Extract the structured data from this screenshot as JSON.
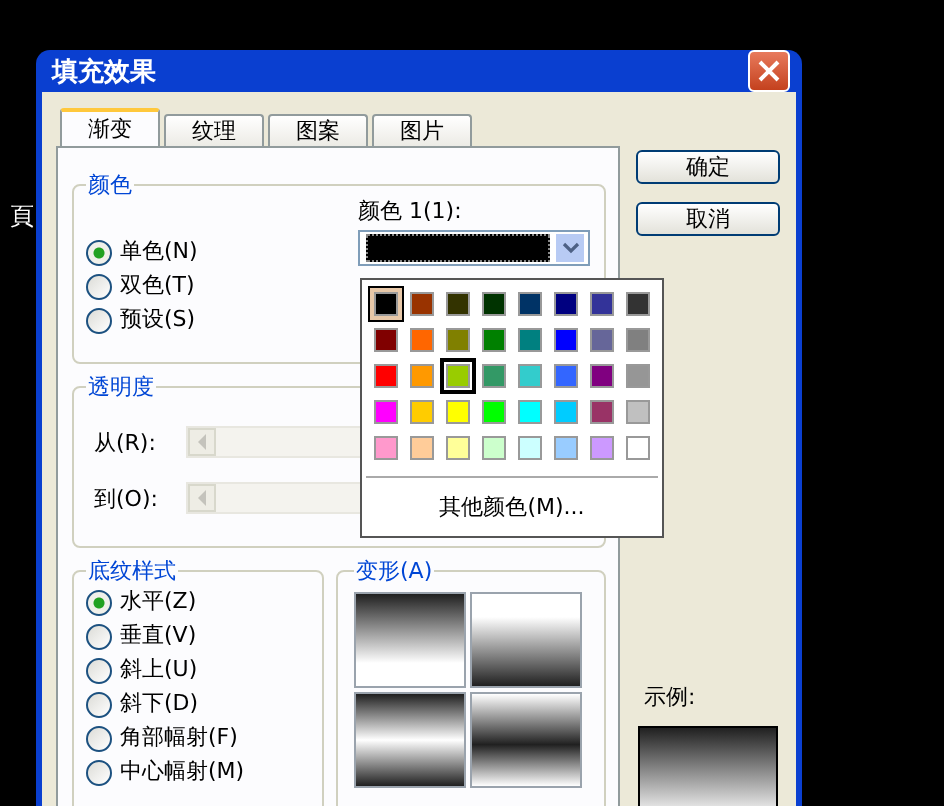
{
  "background_text": "頁",
  "window": {
    "title": "填充效果"
  },
  "tabs": [
    {
      "label": "渐变",
      "selected": true
    },
    {
      "label": "纹理",
      "selected": false
    },
    {
      "label": "图案",
      "selected": false
    },
    {
      "label": "图片",
      "selected": false
    }
  ],
  "color_group": {
    "title": "颜色",
    "options": [
      {
        "label": "单色(N)",
        "selected": true
      },
      {
        "label": "双色(T)",
        "selected": false
      },
      {
        "label": "预设(S)",
        "selected": false
      }
    ],
    "color1_label": "颜色 1(1):"
  },
  "transparency": {
    "title": "透明度",
    "rows": [
      {
        "label": "从(R):",
        "disabled": true
      },
      {
        "label": "到(O):",
        "disabled": true
      }
    ]
  },
  "shading_styles": {
    "title": "底纹样式",
    "options": [
      {
        "label": "水平(Z)",
        "selected": true
      },
      {
        "label": "垂直(V)",
        "selected": false
      },
      {
        "label": "斜上(U)",
        "selected": false
      },
      {
        "label": "斜下(D)",
        "selected": false
      },
      {
        "label": "角部幅射(F)",
        "selected": false
      },
      {
        "label": "中心幅射(M)",
        "selected": false
      }
    ]
  },
  "variants": {
    "title": "变形(A)",
    "items": [
      {
        "kind": "down"
      },
      {
        "kind": "up"
      },
      {
        "kind": "out"
      },
      {
        "kind": "in"
      }
    ]
  },
  "buttons": [
    "确定",
    "取消"
  ],
  "sample": {
    "label": "示例:",
    "kind": "down"
  },
  "color_popup": {
    "swatches": [
      {
        "color": "#000000",
        "selected": true,
        "hovered": false
      },
      {
        "color": "#993300",
        "selected": false,
        "hovered": false
      },
      {
        "color": "#333300",
        "selected": false,
        "hovered": false
      },
      {
        "color": "#003300",
        "selected": false,
        "hovered": false
      },
      {
        "color": "#003366",
        "selected": false,
        "hovered": false
      },
      {
        "color": "#000080",
        "selected": false,
        "hovered": false
      },
      {
        "color": "#333399",
        "selected": false,
        "hovered": false
      },
      {
        "color": "#333333",
        "selected": false,
        "hovered": false
      },
      {
        "color": "#800000",
        "selected": false,
        "hovered": false
      },
      {
        "color": "#ff6600",
        "selected": false,
        "hovered": false
      },
      {
        "color": "#808000",
        "selected": false,
        "hovered": false
      },
      {
        "color": "#008000",
        "selected": false,
        "hovered": false
      },
      {
        "color": "#008080",
        "selected": false,
        "hovered": false
      },
      {
        "color": "#0000ff",
        "selected": false,
        "hovered": false
      },
      {
        "color": "#666699",
        "selected": false,
        "hovered": false
      },
      {
        "color": "#808080",
        "selected": false,
        "hovered": false
      },
      {
        "color": "#ff0000",
        "selected": false,
        "hovered": false
      },
      {
        "color": "#ff9900",
        "selected": false,
        "hovered": false
      },
      {
        "color": "#99cc00",
        "selected": false,
        "hovered": true
      },
      {
        "color": "#339966",
        "selected": false,
        "hovered": false
      },
      {
        "color": "#33cccc",
        "selected": false,
        "hovered": false
      },
      {
        "color": "#3366ff",
        "selected": false,
        "hovered": false
      },
      {
        "color": "#800080",
        "selected": false,
        "hovered": false
      },
      {
        "color": "#969696",
        "selected": false,
        "hovered": false
      },
      {
        "color": "#ff00ff",
        "selected": false,
        "hovered": false
      },
      {
        "color": "#ffcc00",
        "selected": false,
        "hovered": false
      },
      {
        "color": "#ffff00",
        "selected": false,
        "hovered": false
      },
      {
        "color": "#00ff00",
        "selected": false,
        "hovered": false
      },
      {
        "color": "#00ffff",
        "selected": false,
        "hovered": false
      },
      {
        "color": "#00ccff",
        "selected": false,
        "hovered": false
      },
      {
        "color": "#993366",
        "selected": false,
        "hovered": false
      },
      {
        "color": "#c0c0c0",
        "selected": false,
        "hovered": false
      },
      {
        "color": "#ff99cc",
        "selected": false,
        "hovered": false
      },
      {
        "color": "#ffcc99",
        "selected": false,
        "hovered": false
      },
      {
        "color": "#ffff99",
        "selected": false,
        "hovered": false
      },
      {
        "color": "#ccffcc",
        "selected": false,
        "hovered": false
      },
      {
        "color": "#ccffff",
        "selected": false,
        "hovered": false
      },
      {
        "color": "#99ccff",
        "selected": false,
        "hovered": false
      },
      {
        "color": "#cc99ff",
        "selected": false,
        "hovered": false
      },
      {
        "color": "#ffffff",
        "selected": false,
        "hovered": false
      }
    ],
    "more_colors": "其他颜色(M)..."
  }
}
